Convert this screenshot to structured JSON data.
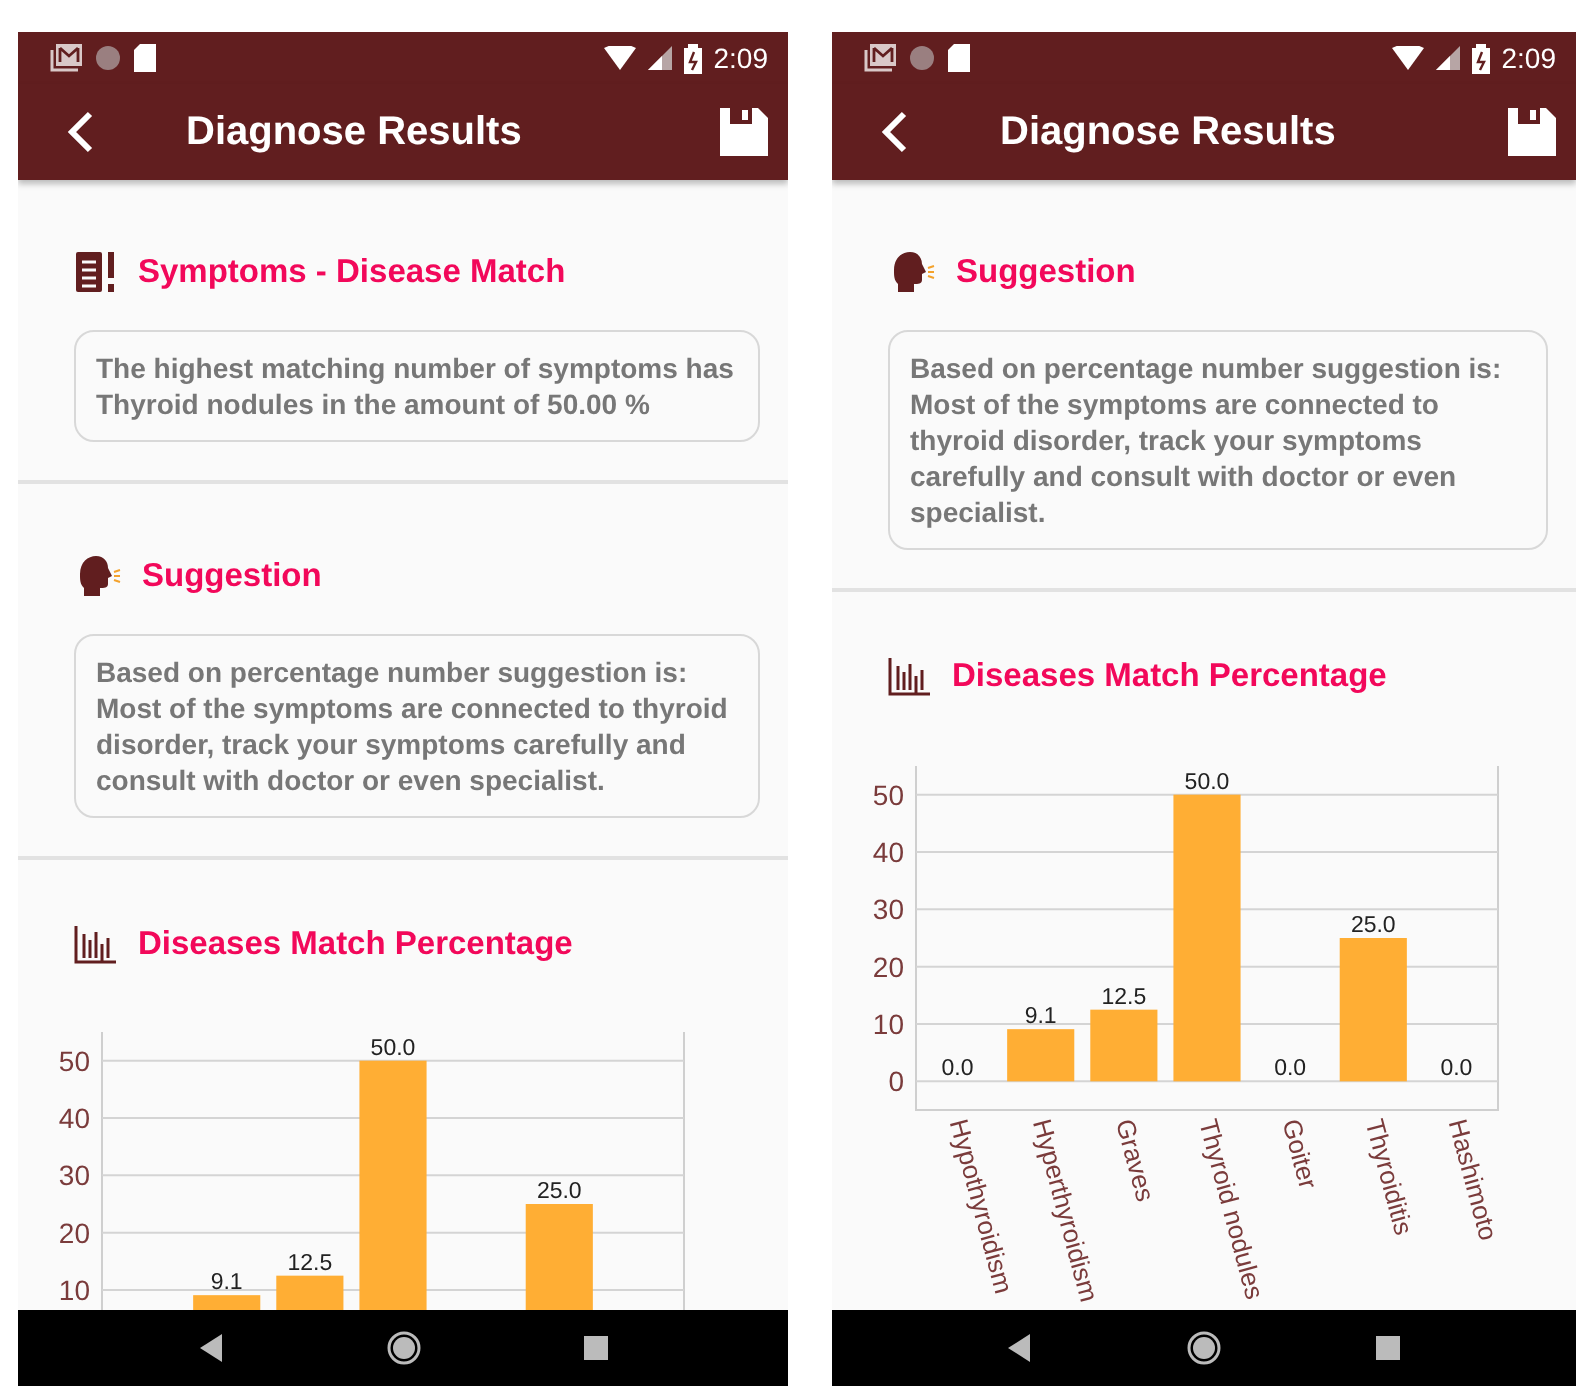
{
  "phones": [
    {
      "status_bar": {
        "time": "2:09"
      },
      "app_bar": {
        "title": "Diagnose Results"
      },
      "sections": [
        {
          "kind": "symptoms",
          "title": "Symptoms - Disease Match",
          "body": "The highest matching number of symptoms has Thyroid nodules  in the amount of 50.00 %"
        },
        {
          "kind": "suggestion",
          "title": "Suggestion",
          "body": "Based on percentage number suggestion is: Most of the symptoms are connected to thyroid disorder, track your symptoms carefully and consult with doctor or even specialist."
        },
        {
          "kind": "chart",
          "title": "Diseases Match Percentage",
          "chart_data": {
            "type": "bar",
            "values": [
              null,
              9.1,
              12.5,
              50.0,
              null,
              25.0,
              null
            ],
            "ylim": [
              -5,
              55
            ],
            "yticks": [
              10,
              20,
              30,
              40,
              50
            ],
            "grid": true,
            "value_labels": [
              null,
              "9.1",
              "12.5",
              "50.0",
              null,
              "25.0",
              null
            ]
          }
        }
      ]
    },
    {
      "status_bar": {
        "time": "2:09"
      },
      "app_bar": {
        "title": "Diagnose Results"
      },
      "sections": [
        {
          "kind": "suggestion",
          "title": "Suggestion",
          "body": "Based on percentage number suggestion is: Most of the symptoms are connected to thyroid disorder, track your symptoms carefully and consult with doctor or even specialist."
        },
        {
          "kind": "chart",
          "title": "Diseases Match Percentage",
          "chart_data": {
            "type": "bar",
            "categories": [
              "Hypothyroidism",
              "Hyperthyroidism",
              "Graves",
              "Thyroid nodules",
              "Goiter",
              "Thyroiditis",
              "Hashimoto"
            ],
            "values": [
              0.0,
              9.1,
              12.5,
              50.0,
              0.0,
              25.0,
              0.0
            ],
            "ylim": [
              -5,
              55
            ],
            "yticks": [
              0,
              10,
              20,
              30,
              40,
              50
            ],
            "grid": true,
            "value_labels": [
              "0.0",
              "9.1",
              "12.5",
              "50.0",
              "0.0",
              "25.0",
              "0.0"
            ]
          }
        }
      ]
    }
  ]
}
